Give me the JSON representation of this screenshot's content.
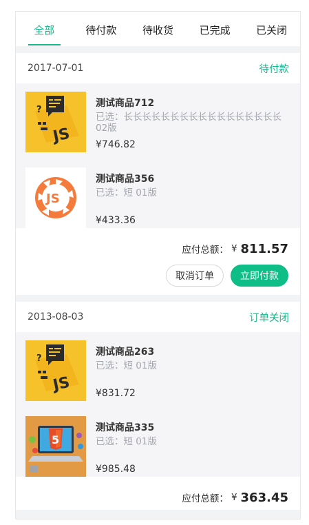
{
  "tabs": [
    {
      "label": "全部",
      "active": true
    },
    {
      "label": "待付款",
      "active": false
    },
    {
      "label": "待收货",
      "active": false
    },
    {
      "label": "已完成",
      "active": false
    },
    {
      "label": "已关闭",
      "active": false
    }
  ],
  "colors": {
    "accent": "#17b889",
    "button_primary": "#0fbd86"
  },
  "orders": [
    {
      "date": "2017-07-01",
      "status": "待付款",
      "goods": [
        {
          "name": "测试商品712",
          "spec": "已选：长长长长长长长长长长长长长长长长长 02版",
          "price": "¥746.82",
          "image_icon": "js-sticky-note-icon"
        },
        {
          "name": "测试商品356",
          "spec": "已选：短 01版",
          "price": "¥433.36",
          "image_icon": "js-shutter-logo-icon"
        }
      ],
      "total_label": "应付总额：",
      "currency": "¥",
      "total": "811.57",
      "buttons": {
        "cancel": "取消订单",
        "pay": "立即付款"
      }
    },
    {
      "date": "2013-08-03",
      "status": "订单关闭",
      "goods": [
        {
          "name": "测试商品263",
          "spec": "已选：短 01版",
          "price": "¥831.72",
          "image_icon": "js-sticky-note-icon"
        },
        {
          "name": "测试商品335",
          "spec": "已选：短 01版",
          "price": "¥985.48",
          "image_icon": "html5-laptop-icon"
        }
      ],
      "total_label": "应付总额：",
      "currency": "¥",
      "total": "363.45"
    }
  ]
}
